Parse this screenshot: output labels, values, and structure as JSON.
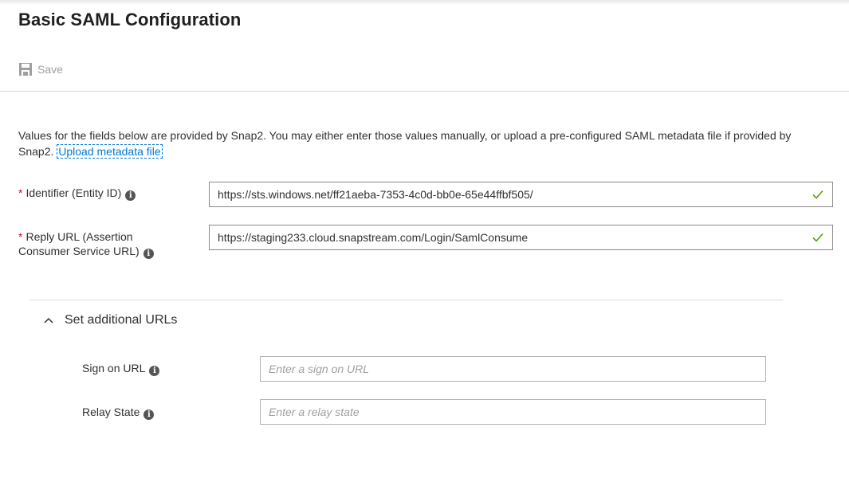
{
  "page": {
    "title": "Basic SAML Configuration"
  },
  "toolbar": {
    "save_label": "Save",
    "save_icon": "save-icon"
  },
  "intro": {
    "text": "Values for the fields below are provided by Snap2. You may either enter those values manually, or upload a pre-configured SAML metadata file if provided by Snap2. ",
    "link_label": "Upload metadata file"
  },
  "fields": {
    "identifier": {
      "required_mark": "*",
      "label": "Identifier (Entity ID)",
      "value": "https://sts.windows.net/ff21aeba-7353-4c0d-bb0e-65e44ffbf505/",
      "valid": true
    },
    "reply_url": {
      "required_mark": "*",
      "label_line1": "Reply URL (Assertion",
      "label_line2": "Consumer Service URL)",
      "value": "https://staging233.cloud.snapstream.com/Login/SamlConsume",
      "valid": true
    }
  },
  "additional": {
    "toggle_label": "Set additional URLs",
    "expanded": true,
    "sign_on": {
      "label": "Sign on URL",
      "placeholder": "Enter a sign on URL",
      "value": ""
    },
    "relay_state": {
      "label": "Relay State",
      "placeholder": "Enter a relay state",
      "value": ""
    }
  },
  "colors": {
    "link": "#0078d4",
    "required": "#c50f1f",
    "valid_check": "#57a300"
  }
}
